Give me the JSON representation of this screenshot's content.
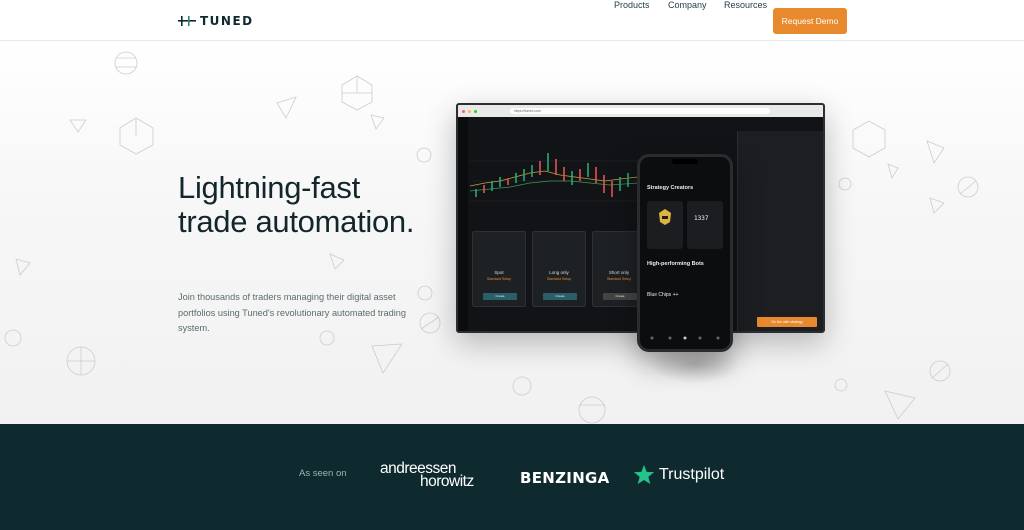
{
  "brand": {
    "name": "TUNED",
    "accent": "#e8892e",
    "dark": "#0f2a2f"
  },
  "nav": {
    "items": [
      {
        "label": "Products"
      },
      {
        "label": "Company"
      },
      {
        "label": "Resources"
      }
    ],
    "cta_label": "Request Demo"
  },
  "hero": {
    "headline_line1": "Lightning-fast",
    "headline_line2": "trade automation.",
    "subtitle": "Join thousands of traders managing their digital asset portfolios using Tuned's revolutionary automated trading system."
  },
  "mockup_desktop": {
    "url": "https://tuned.com",
    "cards": [
      {
        "title": "Spot",
        "subtitle": "Standard Setup",
        "button": "Create"
      },
      {
        "title": "Long only",
        "subtitle": "Standard Setup",
        "button": "Create"
      },
      {
        "title": "Short only",
        "subtitle": "Standard Setup",
        "button": "Create"
      }
    ],
    "start_button": "Go live with strategy"
  },
  "mockup_phone": {
    "section1": "Strategy Creators",
    "section2": "High-performing Bots",
    "row_label": "Blue Chips ++",
    "tile2_value": "1337"
  },
  "press": {
    "label": "As seen on",
    "a16z_line1": "andreessen",
    "a16z_line2": "horowitz",
    "benzinga": "BENZINGA",
    "trustpilot": "Trustpilot"
  }
}
